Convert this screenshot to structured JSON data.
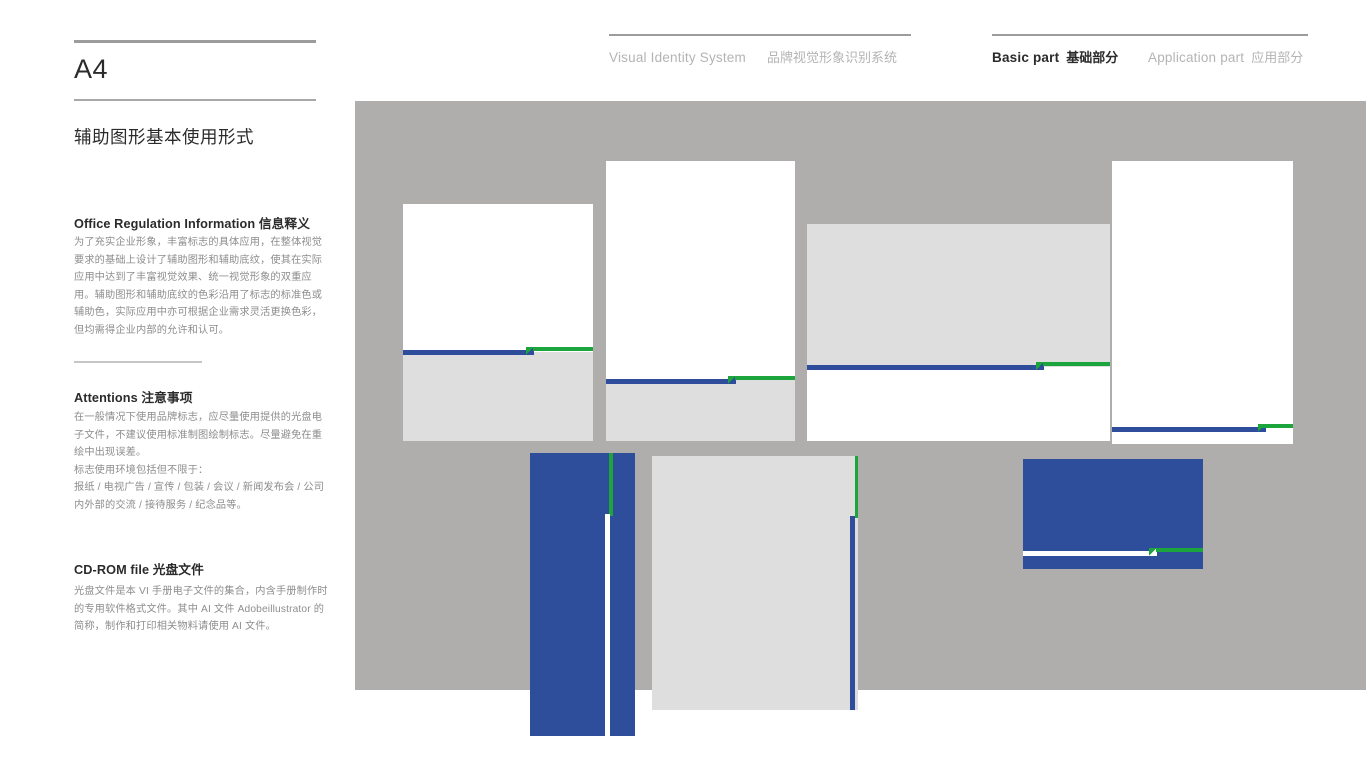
{
  "header": {
    "left_en": "Visual Identity System",
    "left_cn": "品牌视觉形象识别系统",
    "basic_en": "Basic part",
    "basic_cn": "基础部分",
    "app_en": "Application part",
    "app_cn": "应用部分"
  },
  "left": {
    "page_code": "A4",
    "subtitle": "辅助图形基本使用形式",
    "sections": [
      {
        "head_en": "Office Regulation Information",
        "head_cn": "信息释义",
        "body": "为了充实企业形象，丰富标志的具体应用，在整体视觉要求的基础上设计了辅助图形和辅助底纹，使其在实际应用中达到了丰富视觉效果、统一视觉形象的双重应用。辅助图形和辅助底纹的色彩沿用了标志的标准色或辅助色，实际应用中亦可根据企业需求灵活更换色彩，但均需得企业内部的允许和认可。"
      },
      {
        "head_en": "Attentions",
        "head_cn": "注意事项",
        "body": "在一般情况下使用品牌标志，应尽量使用提供的光盘电子文件，不建议使用标准制图绘制标志。尽量避免在重绘中出现误差。\n标志使用环境包括但不限于：\n报纸 / 电视广告 / 宣传 / 包装 / 会议 / 新闻发布会 / 公司内外部的交流 / 接待服务 / 纪念品等。"
      },
      {
        "head_en": "CD-ROM file",
        "head_cn": "光盘文件",
        "body": "光盘文件是本 VI 手册电子文件的集合，内含手册制作时的专用软件格式文件。其中 AI 文件 Adobeillustrator 的简称，制作和打印相关物料请使用 AI 文件。"
      }
    ]
  },
  "colors": {
    "canvas_bg": "#b0adad",
    "brand_blue": "#2e4d9b",
    "brand_green": "#1ca53c",
    "light_gray": "#dedede",
    "white": "#ffffff",
    "rule_gray": "#9c9c9c",
    "text_dark": "#2b2b2b",
    "text_muted": "#8d8d8d"
  },
  "cards": [
    {
      "name": "card-white-gray-1",
      "orientation": "horizontal",
      "top_fill": "#ffffff",
      "bottom_fill": "#dedede",
      "bar_primary": "#2e4d9b",
      "bar_accent": "#1ca53c"
    },
    {
      "name": "card-white-gray-2",
      "orientation": "horizontal",
      "top_fill": "#ffffff",
      "bottom_fill": "#dedede",
      "bar_primary": "#2e4d9b",
      "bar_accent": "#1ca53c"
    },
    {
      "name": "card-gray-white-3",
      "orientation": "horizontal",
      "top_fill": "#dedede",
      "bottom_fill": "#ffffff",
      "bar_primary": "#2e4d9b",
      "bar_accent": "#1ca53c"
    },
    {
      "name": "card-white-tall-4",
      "orientation": "horizontal",
      "top_fill": "#ffffff",
      "bottom_fill": "#ffffff",
      "bar_primary": "#2e4d9b",
      "bar_accent": "#1ca53c"
    },
    {
      "name": "card-blue-vertical-5",
      "orientation": "vertical",
      "top_fill": "#2e4d9b",
      "bottom_fill": "#2e4d9b",
      "bar_primary": "#ffffff",
      "bar_accent": "#1ca53c"
    },
    {
      "name": "card-gray-vertical-6",
      "orientation": "vertical",
      "top_fill": "#dedede",
      "bottom_fill": "#dedede",
      "bar_primary": "#2e4d9b",
      "bar_accent": "#1ca53c"
    },
    {
      "name": "card-blue-wide-7",
      "orientation": "horizontal",
      "top_fill": "#2e4d9b",
      "bottom_fill": "#2e4d9b",
      "bar_primary": "#ffffff",
      "bar_accent": "#1ca53c"
    }
  ]
}
